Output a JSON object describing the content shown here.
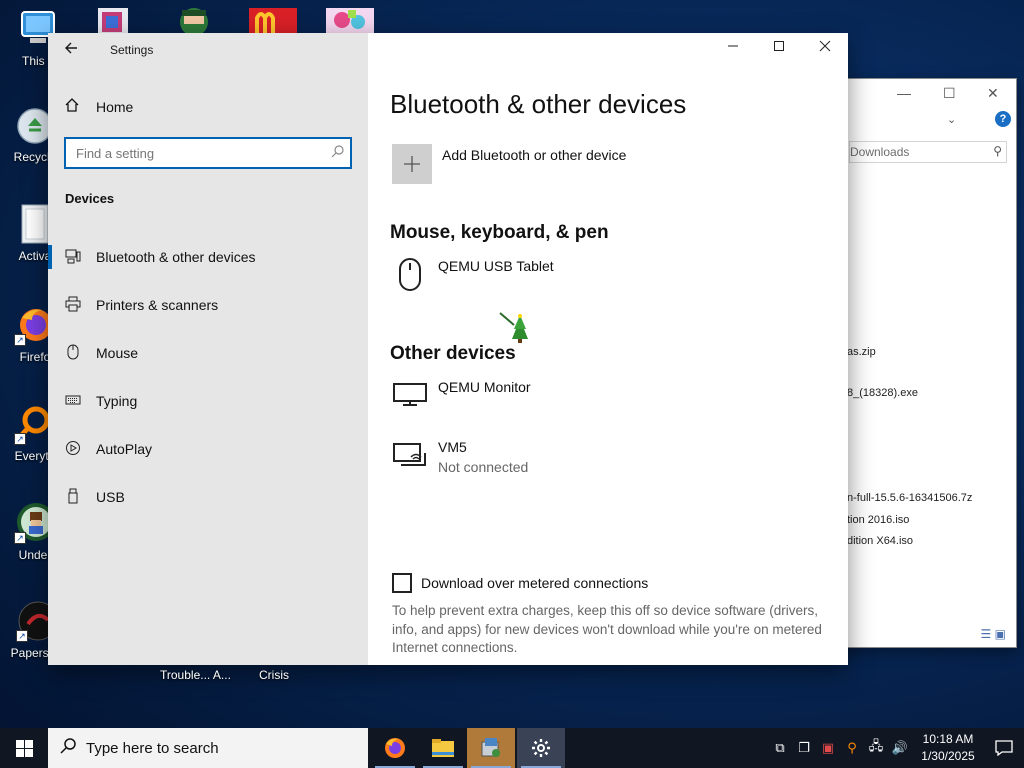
{
  "desktop": {
    "icons": [
      {
        "label": "This P",
        "icon": "computer-icon"
      },
      {
        "label": "Recycle",
        "icon": "recycle-bin-icon"
      },
      {
        "label": "Activa",
        "icon": "folder-icon"
      },
      {
        "label": "Firefo",
        "icon": "firefox-icon"
      },
      {
        "label": "Everyth",
        "icon": "everything-search-icon"
      },
      {
        "label": "Under",
        "icon": "undertale-icon"
      },
      {
        "label": "Papers, P",
        "icon": "papers-please-icon"
      }
    ],
    "bottom_labels": [
      "Trouble... A...",
      "Crisis"
    ]
  },
  "explorer": {
    "address": "Downloads",
    "files": [
      "as.zip",
      "8_(18328).exe",
      "n-full-15.5.6-16341506.7z",
      "tion 2016.iso",
      "dition X64.iso"
    ]
  },
  "settings": {
    "app_title": "Settings",
    "home_label": "Home",
    "search_placeholder": "Find a setting",
    "section": "Devices",
    "nav": [
      {
        "label": "Bluetooth & other devices",
        "icon": "bluetooth-devices-icon",
        "active": true
      },
      {
        "label": "Printers & scanners",
        "icon": "printer-icon",
        "active": false
      },
      {
        "label": "Mouse",
        "icon": "mouse-icon",
        "active": false
      },
      {
        "label": "Typing",
        "icon": "keyboard-icon",
        "active": false
      },
      {
        "label": "AutoPlay",
        "icon": "autoplay-icon",
        "active": false
      },
      {
        "label": "USB",
        "icon": "usb-icon",
        "active": false
      }
    ],
    "page_title": "Bluetooth & other devices",
    "add_device_label": "Add Bluetooth or other device",
    "groups": {
      "mouse_keyboard_pen": {
        "title": "Mouse, keyboard, & pen",
        "devices": [
          {
            "name": "QEMU USB Tablet",
            "status": "",
            "icon": "mouse-icon"
          }
        ]
      },
      "other": {
        "title": "Other devices",
        "devices": [
          {
            "name": "QEMU Monitor",
            "status": "",
            "icon": "monitor-icon"
          },
          {
            "name": "VM5",
            "status": "Not connected",
            "icon": "network-device-icon"
          }
        ]
      }
    },
    "metered": {
      "label": "Download over metered connections",
      "checked": false,
      "description": "To help prevent extra charges, keep this off so device software (drivers, info, and apps) for new devices won't download while you're on metered Internet connections."
    }
  },
  "taskbar": {
    "search_placeholder": "Type here to search",
    "apps": [
      "firefox-icon",
      "file-explorer-icon",
      "installer-icon",
      "settings-gear-icon"
    ],
    "time": "10:18 AM",
    "date": "1/30/2025"
  },
  "colors": {
    "accent": "#0063b1",
    "sidebar_bg": "#e6e6e6",
    "taskbar_bg": "#101622"
  }
}
